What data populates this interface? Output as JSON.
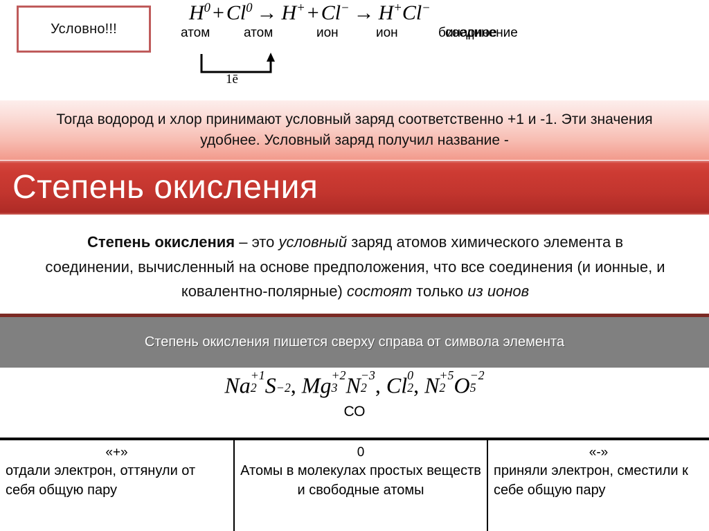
{
  "callout": {
    "label": "Условно!!!",
    "border_color": "#bf5b5b"
  },
  "equation": {
    "terms": [
      {
        "symbol": "H",
        "charge": "0"
      },
      {
        "symbol": "Cl",
        "charge": "0"
      },
      {
        "symbol": "H",
        "charge": "+"
      },
      {
        "symbol": "Cl",
        "charge": "−"
      }
    ],
    "plain": "H⁰ + Cl⁰ → H⁺ + Cl⁻ → H⁺Cl⁻",
    "parts": {
      "h0": "H",
      "h0_sup": "0",
      "plus1": "+",
      "cl0": "Cl",
      "cl0_sup": "0",
      "arrow1": "→",
      "hplus": "H",
      "hplus_sup": "+",
      "plus2": "+",
      "clminus": "Cl",
      "clminus_sup": "−",
      "arrow2": "→",
      "h2": "H",
      "h2_sup": "+",
      "cl2": "Cl",
      "cl2_sup": "−"
    },
    "labels": {
      "atom1": "атом",
      "atom2": "атом",
      "ion1": "ион",
      "ion2": "ион",
      "binary_line1": "бинарное",
      "binary_line2": "соединение"
    },
    "electron_transfer_label": "1ē"
  },
  "pink_band": {
    "text": "Тогда водород и хлор принимают условный заряд соответственно +1 и -1. Эти значения удобнее. Условный заряд получил название -",
    "gradient_top": "#fdeeec",
    "gradient_bottom": "#f29a8c"
  },
  "title_banner": {
    "title": "Степень окисления",
    "background": "#c2352e",
    "text_color": "#ffffff"
  },
  "definition": {
    "term": "Степень окисления",
    "seg1": " – это ",
    "italic1": "условный",
    "seg2": " заряд атомов химического элемента в соединении, вычисленный на основе предположения, что все соединения (и ионные, и ковалентно-полярные) ",
    "italic2": "состоят",
    "seg3": " только ",
    "italic3": "из ионов"
  },
  "gray_band": {
    "text": "Степень окисления пишется сверху справа от символа элемента",
    "background": "#808080",
    "top_rule_color": "#7b2a24",
    "text_color": "#fdfdfd"
  },
  "formulas": {
    "items": [
      {
        "element": "Na",
        "subscript": "2",
        "superscript": "+1"
      },
      {
        "element": "S",
        "subscript": "",
        "superscript": "−2"
      },
      {
        "element": "Mg",
        "subscript": "3",
        "superscript": "+2"
      },
      {
        "element": "N",
        "subscript": "2",
        "superscript": "−3"
      },
      {
        "element": "Cl",
        "subscript": "2",
        "superscript": "0"
      },
      {
        "element": "N",
        "subscript": "2",
        "superscript": "+5"
      },
      {
        "element": "O",
        "subscript": "5",
        "superscript": "−2"
      }
    ],
    "plain": "Na₂⁺¹S⁻², Mg₃⁺²N₂⁻³, Cl₂⁰, N₂⁺⁵O₅⁻²",
    "comma": ",",
    "caption": "СО"
  },
  "table": {
    "columns": [
      {
        "header": "«+»",
        "body": "отдали электрон, оттянули от себя общую пару"
      },
      {
        "header": "0",
        "body": "Атомы в молекулах простых веществ и свободные атомы"
      },
      {
        "header": "«-»",
        "body": "приняли электрон, сместили к себе общую пару"
      }
    ]
  }
}
